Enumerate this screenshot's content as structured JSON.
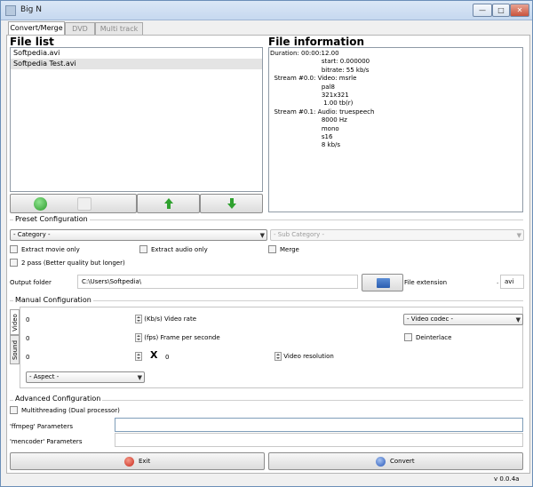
{
  "window": {
    "title": "Big N",
    "controls": {
      "minimize": "—",
      "maximize": "□",
      "close": "✕"
    }
  },
  "tabs": [
    {
      "label": "Convert/Merge",
      "active": true
    },
    {
      "label": "DVD",
      "active": false
    },
    {
      "label": "Multi track",
      "active": false
    }
  ],
  "file_list": {
    "heading": "File list",
    "items": [
      {
        "name": "Softpedia.avi",
        "selected": false
      },
      {
        "name": "Softpedia Test.avi",
        "selected": true
      }
    ],
    "buttons": {
      "add": "add-icon",
      "remove": "trash-icon",
      "up": "arrow-up-icon",
      "down": "arrow-down-icon"
    }
  },
  "file_info": {
    "heading": "File information",
    "lines": [
      "Duration: 00:00:12.00",
      "                          start: 0.000000",
      "                          bitrate: 55 kb/s",
      "  Stream #0.0: Video: msrle",
      "                          pal8",
      "                          321x321",
      "                           1.00 tb(r)",
      "  Stream #0.1: Audio: truespeech",
      "                          8000 Hz",
      "                          mono",
      "                          s16",
      "                          8 kb/s"
    ]
  },
  "preset": {
    "label": "Preset Configuration",
    "category": "- Category -",
    "sub_category": "- Sub Category -",
    "extract_movie": "Extract movie only",
    "extract_audio": "Extract audio only",
    "merge": "Merge",
    "two_pass": "2 pass (Better quality but longer)"
  },
  "output": {
    "folder_label": "Output folder",
    "folder_value": "C:\\Users\\Softpedia\\",
    "ext_label": "File extension",
    "ext_dot": ".",
    "ext_value": "avi",
    "browse_icon": "folder-icon"
  },
  "manual": {
    "label": "Manual Configuration",
    "vtabs": {
      "video": "Video",
      "sound": "Sound"
    },
    "video_rate_value": "0",
    "video_rate_label": "(Kb/s) Video rate",
    "fps_value": "0",
    "fps_label": "(fps) Frame per seconde",
    "res_w": "0",
    "res_x": "X",
    "res_h": "0",
    "res_label": "Video resolution",
    "video_codec": "- Video codec -",
    "deinterlace": "Deinterlace",
    "aspect": "- Aspect -"
  },
  "advanced": {
    "label": "Advanced Configuration",
    "multithreading": "Multithreading (Dual processor)",
    "ffmpeg_label": "'ffmpeg' Parameters",
    "ffmpeg_value": "",
    "mencoder_label": "'mencoder' Parameters",
    "mencoder_value": ""
  },
  "actions": {
    "exit": "Exit",
    "convert": "Convert",
    "exit_icon": "exit-icon",
    "convert_icon": "convert-icon"
  },
  "version": "v 0.0.4a"
}
